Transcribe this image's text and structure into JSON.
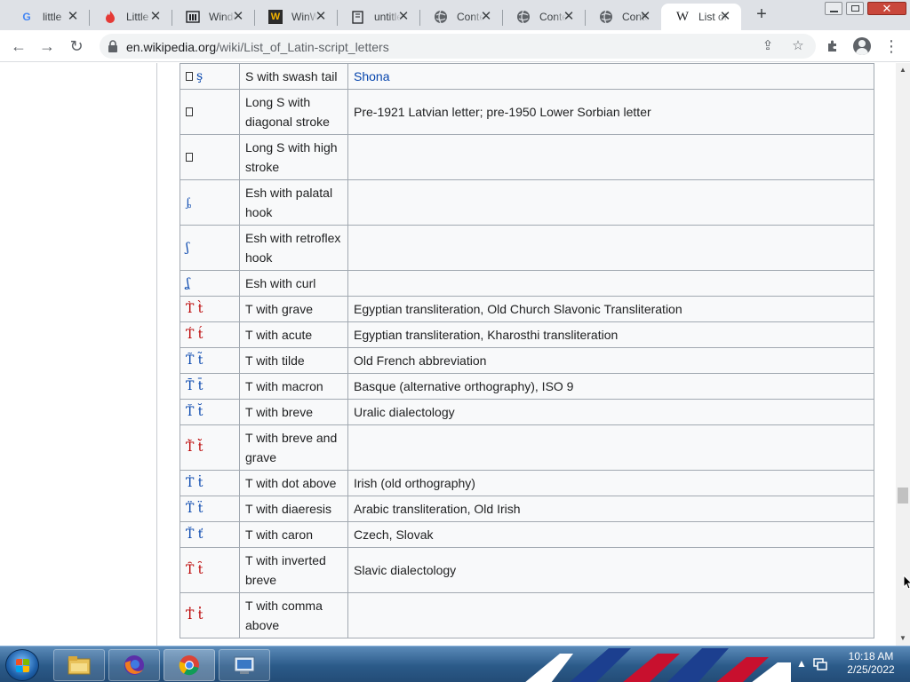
{
  "browser": {
    "tabs": [
      {
        "title": "little",
        "icon": "google-icon"
      },
      {
        "title": "Little",
        "icon": "flame-icon"
      },
      {
        "title": "Windows",
        "icon": "building-icon"
      },
      {
        "title": "WinWorld",
        "icon": "w-logo-icon"
      },
      {
        "title": "untitled",
        "icon": "dictionary-icon"
      },
      {
        "title": "Contents",
        "icon": "globe-icon"
      },
      {
        "title": "Contents",
        "icon": "globe-icon"
      },
      {
        "title": "Contents",
        "icon": "globe-icon"
      },
      {
        "title": "List of Latin-script letters",
        "icon": "wikipedia-icon",
        "active": true
      }
    ],
    "new_tab_label": "+",
    "url_domain": "en.wikipedia.org",
    "url_path": "/wiki/List_of_Latin-script_letters"
  },
  "table": {
    "rows": [
      {
        "glyph": "ş",
        "glyph_color": "#0645ad",
        "has_box": true,
        "name": "S with swash tail",
        "notes": "Shona",
        "notes_link": true
      },
      {
        "glyph": "",
        "glyph_color": "#202122",
        "has_box": true,
        "name": "Long S with diagonal stroke",
        "notes": "Pre-1921 Latvian letter; pre-1950 Lower Sorbian letter"
      },
      {
        "glyph": "",
        "glyph_color": "#202122",
        "has_box": true,
        "name": "Long S with high stroke",
        "notes": ""
      },
      {
        "glyph": "ᶋ",
        "glyph_color": "#0645ad",
        "name": "Esh with palatal hook",
        "notes": ""
      },
      {
        "glyph": "ʃ",
        "glyph_color": "#0645ad",
        "name": "Esh with retroflex hook",
        "notes": ""
      },
      {
        "glyph": "ʆ",
        "glyph_color": "#0645ad",
        "name": "Esh with curl",
        "notes": ""
      },
      {
        "glyph": "T̀ t̀",
        "glyph_color": "#ba0000",
        "name": "T with grave",
        "notes": "Egyptian transliteration, Old Church Slavonic Transliteration"
      },
      {
        "glyph": "T́ t́",
        "glyph_color": "#ba0000",
        "name": "T with acute",
        "notes": "Egyptian transliteration, Kharosthi transliteration"
      },
      {
        "glyph": "T̃ t̃",
        "glyph_color": "#0645ad",
        "name": "T with tilde",
        "notes": "Old French abbreviation"
      },
      {
        "glyph": "T̄ t̄",
        "glyph_color": "#0645ad",
        "name": "T with macron",
        "notes": "Basque (alternative orthography), ISO 9"
      },
      {
        "glyph": "T̆ t̆",
        "glyph_color": "#0645ad",
        "name": "T with breve",
        "notes": "Uralic dialectology"
      },
      {
        "glyph": "T̆̀ t̆̀",
        "glyph_color": "#ba0000",
        "name": "T with breve and grave",
        "notes": ""
      },
      {
        "glyph": "Ṫ ṫ",
        "glyph_color": "#0645ad",
        "name": "T with dot above",
        "notes": "Irish (old orthography)"
      },
      {
        "glyph": "T̈ ẗ",
        "glyph_color": "#0645ad",
        "name": "T with diaeresis",
        "notes": "Arabic transliteration, Old Irish"
      },
      {
        "glyph": "Ť ť",
        "glyph_color": "#0645ad",
        "name": "T with caron",
        "notes": "Czech, Slovak"
      },
      {
        "glyph": "T̑ t̑",
        "glyph_color": "#ba0000",
        "name": "T with inverted breve",
        "notes": "Slavic dialectology"
      },
      {
        "glyph": "T̓ t̓",
        "glyph_color": "#ba0000",
        "name": "T with comma above",
        "notes": ""
      }
    ]
  },
  "taskbar": {
    "time": "10:18 AM",
    "date": "2/25/2022"
  }
}
